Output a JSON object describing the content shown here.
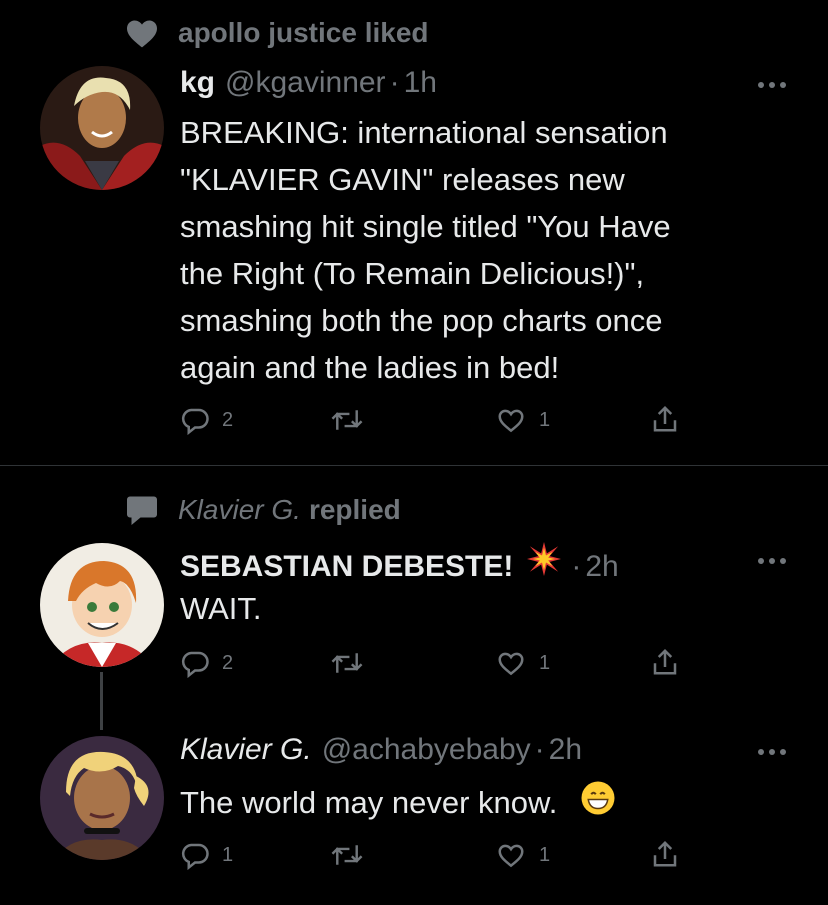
{
  "tweet1": {
    "context": "apollo justice liked",
    "name": "kg",
    "handle": "@kgavinner",
    "dot": "·",
    "time": "1h",
    "lines": [
      "BREAKING: international sensation",
      "\"KLAVIER GAVIN\" releases new",
      "smashing hit single titled \"You Have",
      "the Right (To Remain Delicious!)\",",
      "smashing both the pop charts once",
      "again and the ladies in bed!"
    ],
    "replies": "2",
    "likes": "1"
  },
  "tweet2": {
    "context_name": "Klavier G.",
    "context_action": "replied",
    "name": "SEBASTIAN DEBESTE!",
    "dot": "·",
    "time": "2h",
    "text": "WAIT.",
    "replies": "2",
    "likes": "1"
  },
  "tweet3": {
    "name": "Klavier G.",
    "handle": "@achabyebaby",
    "dot": "·",
    "time": "2h",
    "text": "The world may never know.",
    "replies": "1",
    "likes": "1"
  },
  "colors": {
    "background": "#000000",
    "text": "#e7e9ea",
    "secondary": "#71767b",
    "divider": "#2f3336"
  }
}
